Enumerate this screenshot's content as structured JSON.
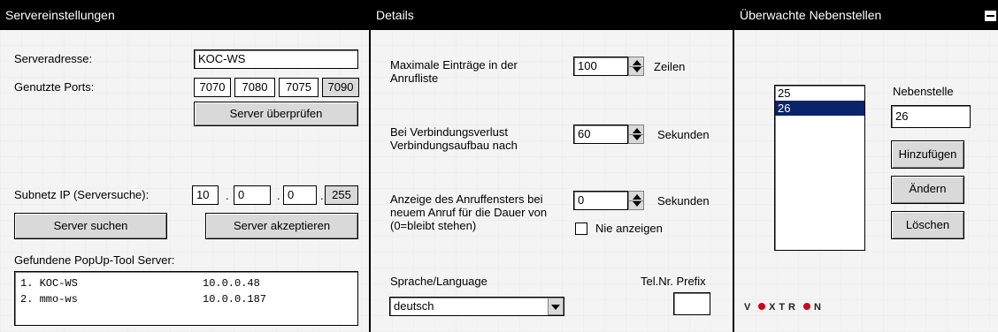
{
  "server": {
    "title": "Servereinstellungen",
    "address_label": "Serveradresse:",
    "address_value": "KOC-WS",
    "ports_label": "Genutzte Ports:",
    "ports": [
      "7070",
      "7080",
      "7075",
      "7090"
    ],
    "check_button": "Server überprüfen",
    "subnet_label": "Subnetz IP (Serversuche):",
    "subnet_octets": [
      "10",
      "0",
      "0",
      "255"
    ],
    "ip_dot": ".",
    "search_button": "Server suchen",
    "accept_button": "Server akzeptieren",
    "found_label": "Gefundene PopUp-Tool Server:",
    "found": [
      {
        "name": "1. KOC-WS",
        "ip": "10.0.0.48"
      },
      {
        "name": "2. mmo-ws",
        "ip": "10.0.0.187"
      }
    ]
  },
  "details": {
    "title": "Details",
    "max_entries_label": "Maximale Einträge in der Anrufliste",
    "max_entries_value": "100",
    "max_entries_unit": "Zeilen",
    "reconnect_label": "Bei Verbindungsverlust Verbindungsaufbau nach",
    "reconnect_value": "60",
    "reconnect_unit": "Sekunden",
    "display_label": "Anzeige des Anruffensters bei neuem Anruf für die Dauer von (0=bleibt stehen)",
    "display_value": "0",
    "display_unit": "Sekunden",
    "never_show_label": "Nie anzeigen",
    "never_show_checked": false,
    "language_label": "Sprache/Language",
    "language_value": "deutsch",
    "prefix_label": "Tel.Nr. Prefix",
    "prefix_value": ""
  },
  "extensions": {
    "title": "Überwachte Nebenstellen",
    "items": [
      "25",
      "26"
    ],
    "selected_index": 1,
    "field_label": "Nebenstelle",
    "field_value": "26",
    "add_button": "Hinzufügen",
    "edit_button": "Ändern",
    "delete_button": "Löschen",
    "logo_text": "VOXTRON"
  },
  "colors": {
    "title_bg": "#000000",
    "panel_bg": "#f4f4f5",
    "selection": "#0a246a",
    "logo_dot": "#d0021b"
  }
}
